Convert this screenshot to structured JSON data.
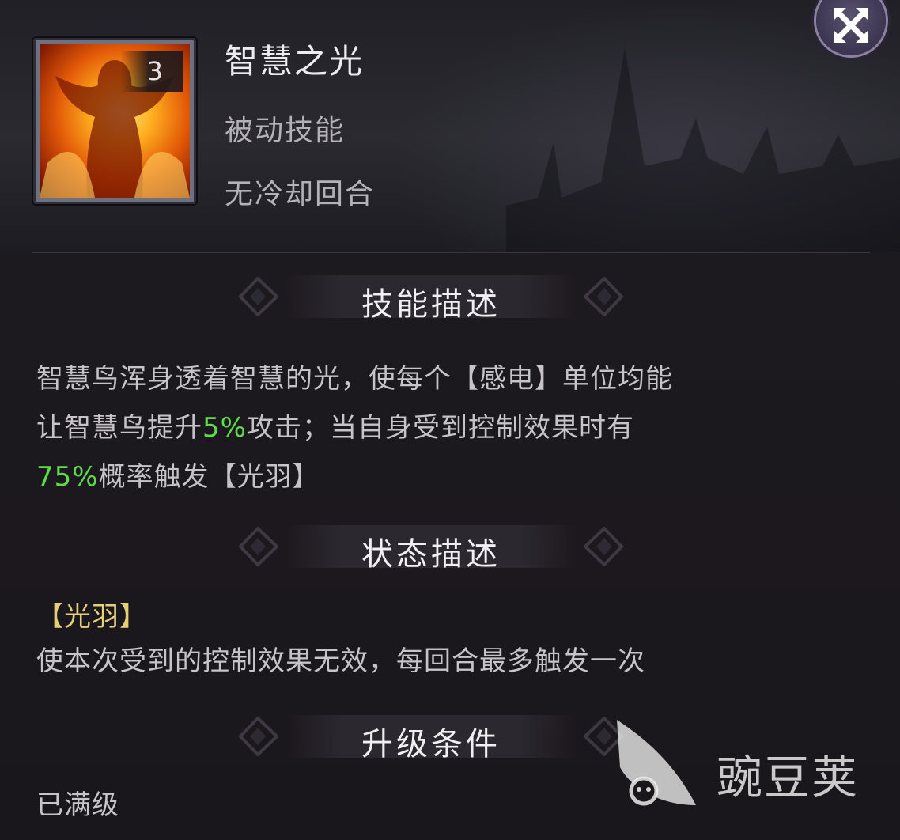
{
  "header": {
    "skill_name": "智慧之光",
    "skill_type": "被动技能",
    "cooldown": "无冷却回合",
    "level": "3"
  },
  "close_icon": "close-arrows-icon",
  "sections": {
    "skill_desc_title": "技能描述",
    "status_desc_title": "状态描述",
    "upgrade_title": "升级条件"
  },
  "skill_description": {
    "line1": "智慧鸟浑身透着智慧的光，使每个【感电】单位均能",
    "line2_pre": "让智慧鸟提升",
    "line2_hl": "5%",
    "line2_post": "攻击；当自身受到控制效果时有",
    "line3_hl": "75%",
    "line3_post": "概率触发【光羽】"
  },
  "status": {
    "name": "【光羽】",
    "description": "使本次受到的控制效果无效，每回合最多触发一次"
  },
  "upgrade": {
    "condition": "已满级"
  },
  "watermark": {
    "text": "豌豆荚"
  },
  "colors": {
    "highlight_green": "#5fdc4a",
    "status_gold": "#e6cf78"
  }
}
